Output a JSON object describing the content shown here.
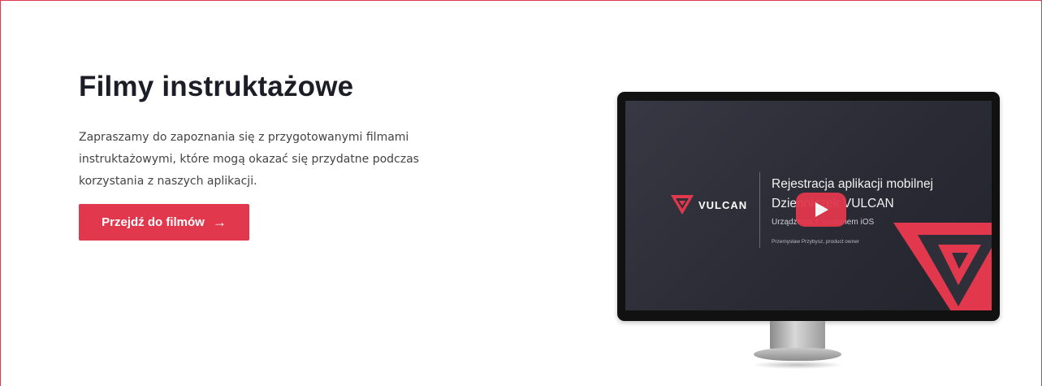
{
  "section": {
    "title": "Filmy instruktażowe",
    "description": "Zapraszamy do zapoznania się z przygotowanymi filmami instruktażowymi, które mogą okazać się przydatne podczas korzystania z naszych aplikacji.",
    "cta_label": "Przejdź do filmów",
    "cta_icon": "arrow-right-icon"
  },
  "video": {
    "logo_text": "VULCAN",
    "title": "Rejestracja aplikacji mobilnej Dzienniczek VULCAN",
    "subtitle": "Urządzenia z systemem iOS",
    "author": "Przemysław Przybysz, product owner",
    "play_icon": "play-icon"
  },
  "colors": {
    "accent": "#e2384d",
    "heading": "#1d1d28",
    "screen": "#2f2f3a"
  }
}
